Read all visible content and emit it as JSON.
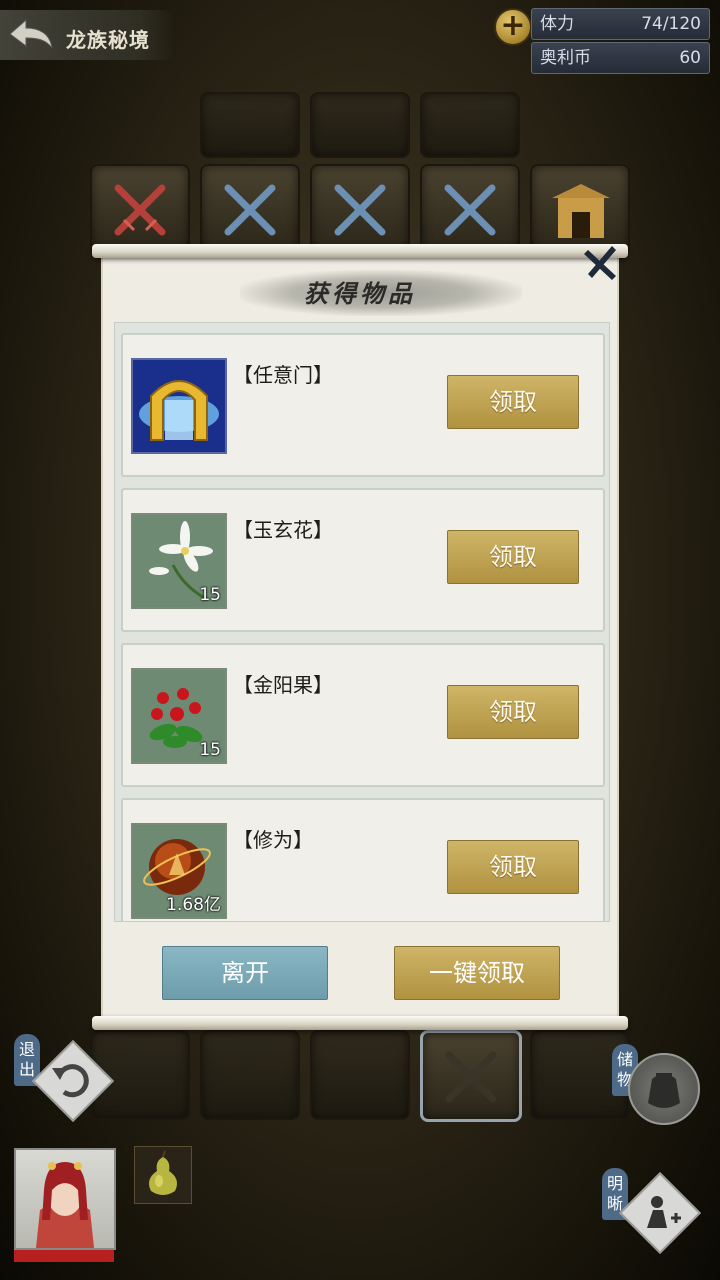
{
  "header": {
    "title": "龙族秘境",
    "resources": [
      {
        "label": "体力",
        "value": "74/120"
      },
      {
        "label": "奥利币",
        "value": "60"
      }
    ]
  },
  "dialog": {
    "title": "获得物品",
    "items": [
      {
        "name": "【任意门】",
        "quantity": "",
        "icon": "golden-gate-icon",
        "claim_label": "领取"
      },
      {
        "name": "【玉玄花】",
        "quantity": "15",
        "icon": "white-flower-icon",
        "claim_label": "领取"
      },
      {
        "name": "【金阳果】",
        "quantity": "15",
        "icon": "red-berry-icon",
        "claim_label": "领取"
      },
      {
        "name": "【修为】",
        "quantity": "1.68亿",
        "icon": "cultivation-orb-icon",
        "claim_label": "领取"
      }
    ],
    "leave_label": "离开",
    "claim_all_label": "一键领取"
  },
  "controls": {
    "exit_label": "退出",
    "storage_label": "储物",
    "clarity_label": "明晰"
  },
  "colors": {
    "gold_button": "#c0a452",
    "blue_button": "#7eaab8",
    "hp_red": "#b81f1f"
  }
}
